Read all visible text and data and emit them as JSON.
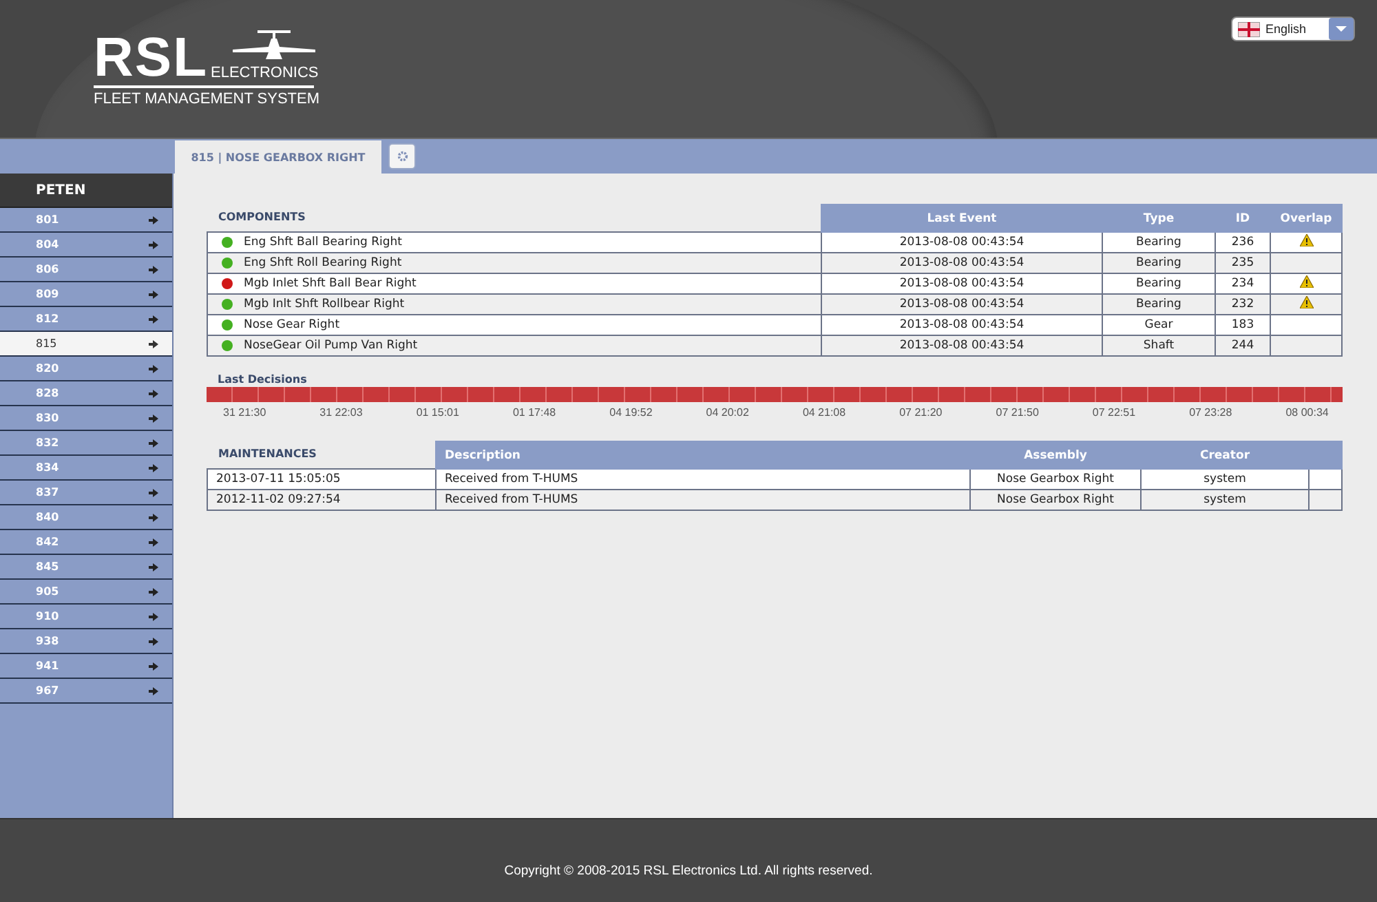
{
  "header": {
    "logo": {
      "mark": "RSL",
      "subtitle": "ELECTRONICS",
      "tagline": "FLEET MANAGEMENT SYSTEM"
    },
    "language": {
      "value": "English"
    }
  },
  "tabs": [
    {
      "label": "815 | NOSE GEARBOX RIGHT",
      "selected": true
    }
  ],
  "sidebar": {
    "title": "PETEN",
    "items": [
      {
        "label": "801",
        "selected": false
      },
      {
        "label": "804",
        "selected": false
      },
      {
        "label": "806",
        "selected": false
      },
      {
        "label": "809",
        "selected": false
      },
      {
        "label": "812",
        "selected": false
      },
      {
        "label": "815",
        "selected": true
      },
      {
        "label": "820",
        "selected": false
      },
      {
        "label": "828",
        "selected": false
      },
      {
        "label": "830",
        "selected": false
      },
      {
        "label": "832",
        "selected": false
      },
      {
        "label": "834",
        "selected": false
      },
      {
        "label": "837",
        "selected": false
      },
      {
        "label": "840",
        "selected": false
      },
      {
        "label": "842",
        "selected": false
      },
      {
        "label": "845",
        "selected": false
      },
      {
        "label": "905",
        "selected": false
      },
      {
        "label": "910",
        "selected": false
      },
      {
        "label": "938",
        "selected": false
      },
      {
        "label": "941",
        "selected": false
      },
      {
        "label": "967",
        "selected": false
      }
    ]
  },
  "components": {
    "title": "COMPONENTS",
    "columns": [
      "Last Event",
      "Type",
      "ID",
      "Overlap"
    ],
    "rows": [
      {
        "name": "Eng Shft Ball Bearing Right",
        "color": "#44b021",
        "last_event": "2013-08-08 00:43:54",
        "type": "Bearing",
        "id": "236",
        "overlap": true
      },
      {
        "name": "Eng Shft Roll Bearing Right",
        "color": "#44b021",
        "last_event": "2013-08-08 00:43:54",
        "type": "Bearing",
        "id": "235",
        "overlap": false
      },
      {
        "name": "Mgb Inlet Shft Ball Bear Right",
        "color": "#d01818",
        "last_event": "2013-08-08 00:43:54",
        "type": "Bearing",
        "id": "234",
        "overlap": true
      },
      {
        "name": "Mgb Inlt Shft Rollbear Right",
        "color": "#44b021",
        "last_event": "2013-08-08 00:43:54",
        "type": "Bearing",
        "id": "232",
        "overlap": true
      },
      {
        "name": "Nose Gear Right",
        "color": "#44b021",
        "last_event": "2013-08-08 00:43:54",
        "type": "Gear",
        "id": "183",
        "overlap": false
      },
      {
        "name": "NoseGear Oil Pump Van Right",
        "color": "#44b021",
        "last_event": "2013-08-08 00:43:54",
        "type": "Shaft",
        "id": "244",
        "overlap": false
      }
    ]
  },
  "last_decisions": {
    "title": "Last Decisions",
    "labels": [
      "31 21:30",
      "31 22:03",
      "01 15:01",
      "01 17:48",
      "04 19:52",
      "04 20:02",
      "04 21:08",
      "07 21:20",
      "07 21:50",
      "07 22:51",
      "07 23:28",
      "08 00:34"
    ]
  },
  "maintenances": {
    "title": "MAINTENANCES",
    "columns": [
      "Description",
      "Assembly",
      "Creator"
    ],
    "rows": [
      {
        "date": "2013-07-11 15:05:05",
        "description": "Received from T-HUMS",
        "assembly": "Nose Gearbox Right",
        "creator": "system"
      },
      {
        "date": "2012-11-02 09:27:54",
        "description": "Received from T-HUMS",
        "assembly": "Nose Gearbox Right",
        "creator": "system"
      }
    ]
  },
  "footer": "Copyright © 2008-2015 RSL Electronics Ltd. All rights reserved."
}
